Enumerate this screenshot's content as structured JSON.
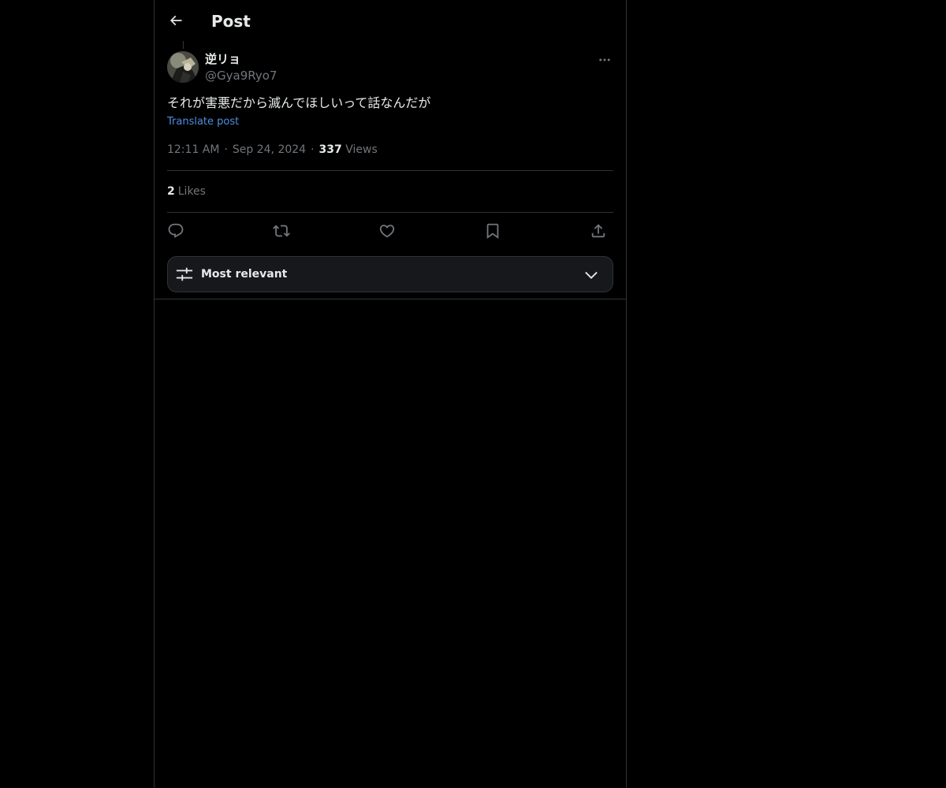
{
  "header": {
    "title": "Post",
    "back_icon": "arrow-left-icon"
  },
  "post": {
    "display_name": "逆リョ",
    "handle": "@Gya9Ryo7",
    "text": "それが害悪だから滅んでほしいって話なんだが",
    "translate_label": "Translate post",
    "time": "12:11 AM",
    "date": "Sep 24, 2024",
    "views_count": "337",
    "views_label": "Views",
    "likes_count": "2",
    "likes_label": "Likes",
    "separator": "·"
  },
  "actions": {
    "reply_icon": "reply-icon",
    "repost_icon": "repost-icon",
    "like_icon": "heart-icon",
    "bookmark_icon": "bookmark-icon",
    "share_icon": "share-icon"
  },
  "sort": {
    "label": "Most relevant",
    "icon": "sliders-icon",
    "chevron": "chevron-down-icon"
  },
  "colors": {
    "background": "#000000",
    "border": "#2f3336",
    "text": "#e7e9ea",
    "muted": "#71767b",
    "link": "#4d8fe0"
  }
}
